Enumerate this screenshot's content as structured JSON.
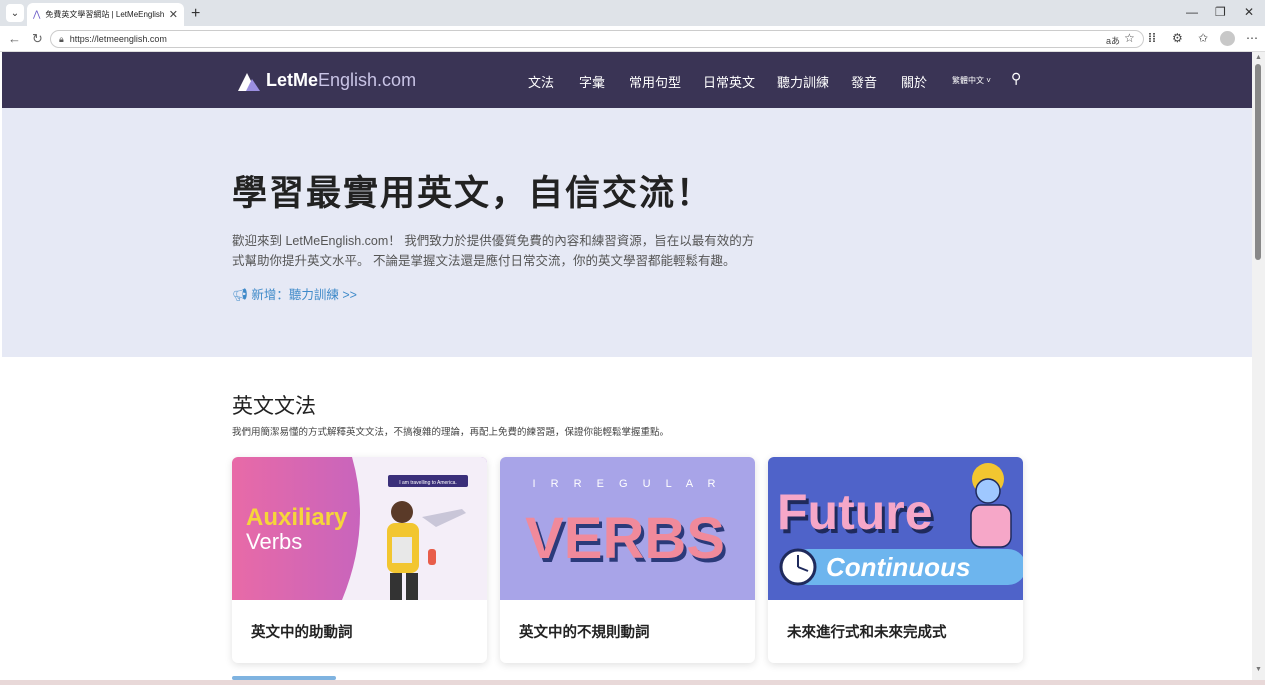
{
  "browser": {
    "tab_title": "免費英文學習網站 | LetMeEnglish.c",
    "url": "https://letmeenglish.com"
  },
  "site": {
    "logo_bold": "LetMe",
    "logo_thin": "English.com",
    "nav": [
      "文法",
      "字彙",
      "常用句型",
      "日常英文",
      "聽力訓練",
      "發音",
      "關於"
    ],
    "language": "繁體中文 ˅"
  },
  "hero": {
    "title": "學習最實用英文，自信交流！",
    "body": "歡迎來到 LetMeEnglish.com！ 我們致力於提供優質免費的內容和練習資源，旨在以最有效的方式幫助你提升英文水平。 不論是掌握文法還是應付日常交流，你的英文學習都能輕鬆有趣。",
    "new_link": "新增：聽力訓練 >>"
  },
  "section": {
    "title": "英文文法",
    "subtitle": "我們用簡潔易懂的方式解釋英文文法，不搞複雜的理論，再配上免費的練習題，保證你能輕鬆掌握重點。"
  },
  "cards": [
    {
      "title": "英文中的助動詞",
      "img_line1": "Auxiliary",
      "img_line2": "Verbs",
      "img_bubble": "I am travelling to America."
    },
    {
      "title": "英文中的不規則動詞",
      "img_top": "I R R E G U L A R",
      "img_main": "VERBS"
    },
    {
      "title": "未來進行式和未來完成式",
      "img_line1": "Future",
      "img_line2": "Continuous"
    }
  ]
}
